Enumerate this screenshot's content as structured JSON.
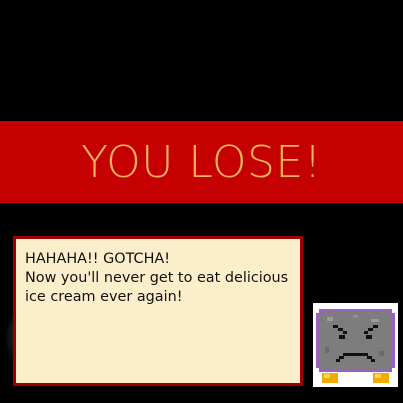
{
  "banner": {
    "title": "YOU LOSE!"
  },
  "dialog": {
    "lines": [
      "HAHAHA!! GOTCHA!",
      "Now you'll never get to eat delicious",
      "ice cream ever again!"
    ]
  },
  "portrait": {
    "icon": "angry-block-enemy-icon"
  },
  "colors": {
    "background": "#000000",
    "banner_red": "#c40000",
    "banner_text": "#f7b25a",
    "dialog_fill": "#fbefcb",
    "dialog_border": "#9b0000"
  }
}
